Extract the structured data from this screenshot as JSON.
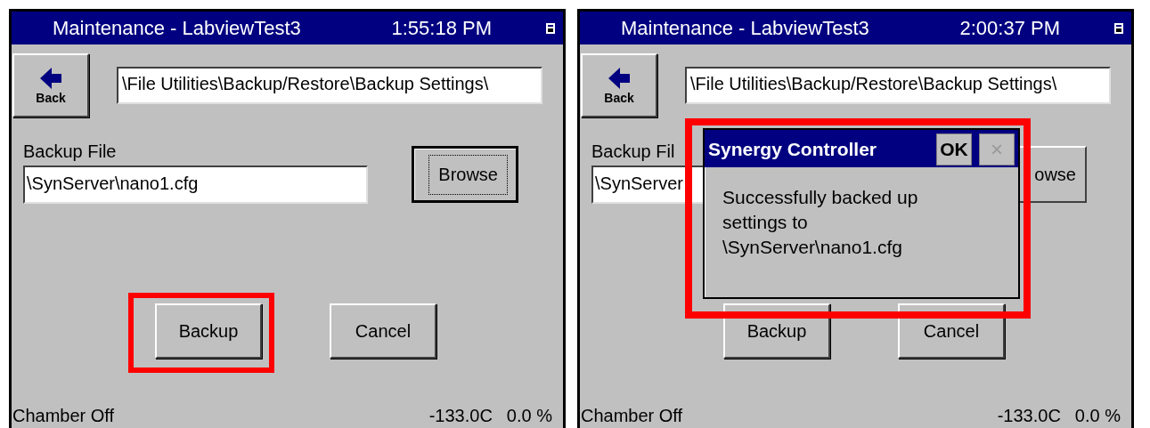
{
  "screens": [
    {
      "title": "Maintenance - LabviewTest3",
      "time": "1:55:18 PM",
      "back_label": "Back",
      "path": "\\File Utilities\\Backup/Restore\\Backup Settings\\",
      "file_label": "Backup File",
      "file_value": "\\SynServer\\nano1.cfg",
      "browse": {
        "label": "Browse",
        "focused": true
      },
      "buttons": [
        {
          "label": "Backup",
          "highlighted": true
        },
        {
          "label": "Cancel",
          "highlighted": false
        }
      ],
      "status": "Chamber Off",
      "temperature": "-133.0C",
      "percent": "0.0 %"
    },
    {
      "title": "Maintenance - LabviewTest3",
      "time": "2:00:37 PM",
      "back_label": "Back",
      "path": "\\File Utilities\\Backup/Restore\\Backup Settings\\",
      "file_label": "Backup Fil",
      "file_value": "\\SynServer",
      "browse": {
        "label": "owse",
        "focused": false
      },
      "buttons": [
        {
          "label": "Backup",
          "highlighted": false
        },
        {
          "label": "Cancel",
          "highlighted": false
        }
      ],
      "status": "Chamber Off",
      "temperature": "-133.0C",
      "percent": "0.0 %",
      "dialog": {
        "title": "Synergy Controller",
        "ok": "OK",
        "close": "×",
        "message": "Successfully backed up settings to \\SynServer\\nano1.cfg",
        "highlighted": true
      }
    }
  ]
}
